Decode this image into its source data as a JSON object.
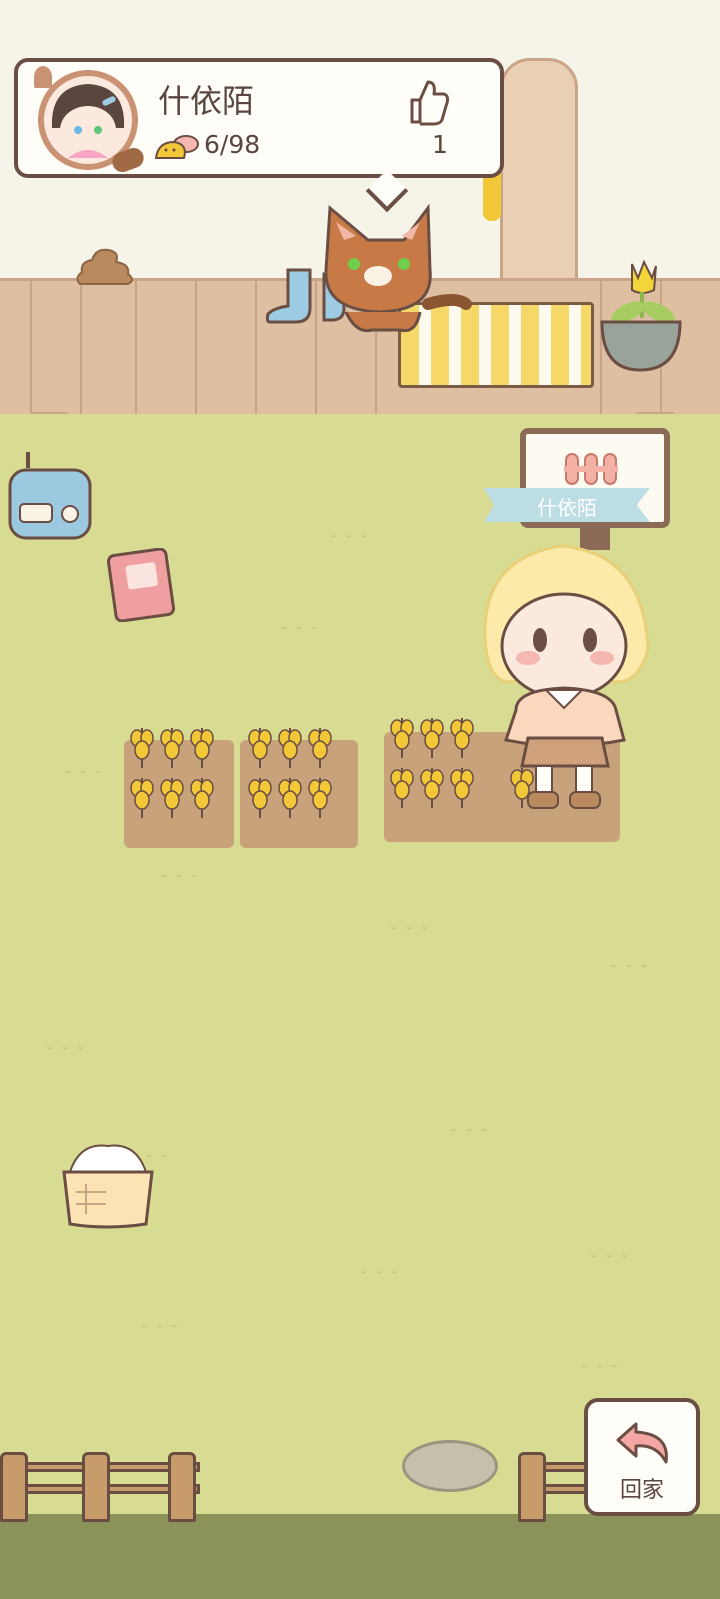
{
  "profile": {
    "name": "什依陌",
    "fish_count": "6/98",
    "like_count": "1",
    "avatar_icon": "girl-avatar-icon",
    "fish_icon": "fish-icon",
    "like_icon": "thumbs-up-icon"
  },
  "sign": {
    "name": "什依陌",
    "icon": "fence-icon"
  },
  "buttons": {
    "back_home_label": "回家",
    "back_home_icon": "return-arrow-icon"
  },
  "scene": {
    "items": [
      "cat",
      "boots",
      "poop",
      "striped-mat",
      "tulip-pot",
      "radio",
      "notebook",
      "flour-basket",
      "stone",
      "farmer-girl",
      "wheat-plots",
      "fence"
    ],
    "colors": {
      "grass": "#d8dc93",
      "wall": "#f6f3e8",
      "deck": "#dfbfa2",
      "outline": "#6b4e43",
      "wheat": "#f3c838",
      "ribbon": "#bcdde4"
    }
  }
}
